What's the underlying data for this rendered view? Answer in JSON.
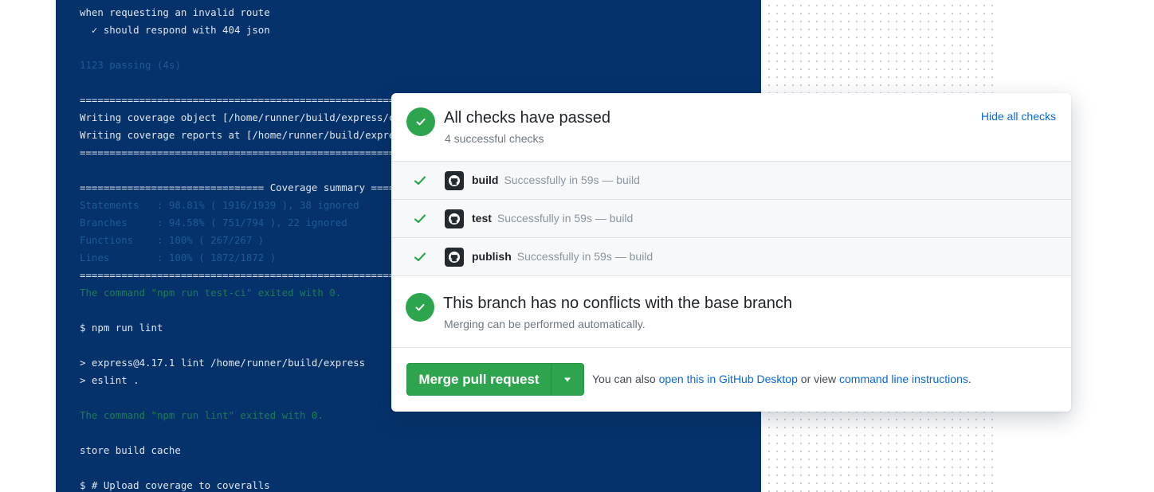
{
  "terminal": {
    "lines": [
      {
        "text": "when requesting an invalid route",
        "tone": "white"
      },
      {
        "text": "  ✓ should respond with 404 json",
        "tone": "white"
      },
      {
        "text": "1123 passing (4s)",
        "tone": "dim"
      },
      {
        "text": "=============================================================================",
        "tone": "white"
      },
      {
        "text": "Writing coverage object [/home/runner/build/express/coverage/coverage.json]",
        "tone": "white"
      },
      {
        "text": "Writing coverage reports at [/home/runner/build/express/coverage]",
        "tone": "white"
      },
      {
        "text": "=============================================================================",
        "tone": "white"
      },
      {
        "text": "=============================== Coverage summary ===============================",
        "tone": "white"
      },
      {
        "text": "Statements   : 98.81% ( 1916/1939 ), 38 ignored",
        "tone": "dim"
      },
      {
        "text": "Branches     : 94.58% ( 751/794 ), 22 ignored",
        "tone": "dim"
      },
      {
        "text": "Functions    : 100% ( 267/267 )",
        "tone": "dim"
      },
      {
        "text": "Lines        : 100% ( 1872/1872 )",
        "tone": "dim"
      },
      {
        "text": "=============================================================================",
        "tone": "white"
      },
      {
        "text": "The command \"npm run test-ci\" exited with 0.",
        "tone": "green"
      },
      {
        "text": "$ npm run lint",
        "tone": "white"
      },
      {
        "text": "> express@4.17.1 lint /home/runner/build/express",
        "tone": "white"
      },
      {
        "text": "> eslint .",
        "tone": "white"
      },
      {
        "text": "The command \"npm run lint\" exited with 0.",
        "tone": "green"
      },
      {
        "text": "store build cache",
        "tone": "white"
      },
      {
        "text": "$ # Upload coverage to coveralls",
        "tone": "white"
      }
    ]
  },
  "checks": {
    "title": "All checks have passed",
    "subtitle": "4 successful checks",
    "hide_link": "Hide all checks",
    "items": [
      {
        "name": "build",
        "description": "Successfully in 59s — build"
      },
      {
        "name": "test",
        "description": "Successfully in 59s — build"
      },
      {
        "name": "publish",
        "description": "Successfully in 59s — build"
      }
    ]
  },
  "merge_status": {
    "title": "This branch has no conflicts with the base branch",
    "subtitle": "Merging can be performed automatically."
  },
  "merge_bar": {
    "button_label": "Merge pull request",
    "note_prefix": "You can also ",
    "desktop_link": "open this in GitHub Desktop",
    "note_middle": " or view ",
    "cli_link": "command line instructions",
    "note_suffix": "."
  },
  "colors": {
    "terminal_bg": "#05326b",
    "success_green": "#2da44e",
    "link_blue": "#0969da"
  }
}
